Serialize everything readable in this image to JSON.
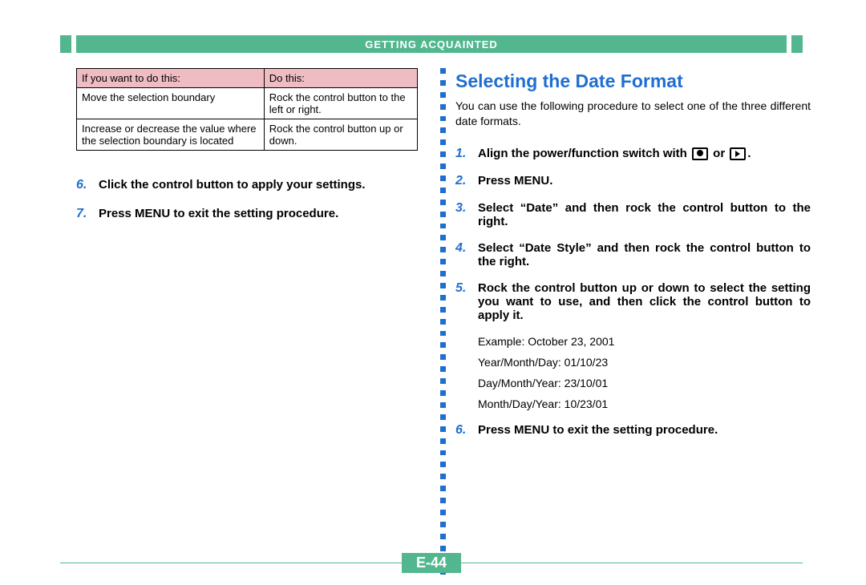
{
  "header": {
    "section": "GETTING ACQUAINTED"
  },
  "left": {
    "table": {
      "head1": "If you want to do this:",
      "head2": "Do this:",
      "rows": [
        {
          "c1": "Move the selection boundary",
          "c2": "Rock the control button to the left or right."
        },
        {
          "c1": "Increase or decrease the value where the selection boundary is located",
          "c2": "Rock the control button up or down."
        }
      ]
    },
    "steps": [
      {
        "n": "6.",
        "t": "Click the control button to apply your settings."
      },
      {
        "n": "7.",
        "t": "Press MENU to exit the setting procedure."
      }
    ]
  },
  "right": {
    "title": "Selecting the Date Format",
    "lead": "You can use the following procedure to select one of the three different date formats.",
    "steps": [
      {
        "n": "1.",
        "t_pre": "Align the power/function switch with ",
        "t_post": " or ",
        "t_end": "."
      },
      {
        "n": "2.",
        "t": "Press MENU."
      },
      {
        "n": "3.",
        "t": "Select “Date” and then rock the control button to the right."
      },
      {
        "n": "4.",
        "t": "Select “Date Style” and then rock the control button to the right."
      },
      {
        "n": "5.",
        "t": "Rock the control button up or down to select the setting you want to use, and then click the control button to apply it."
      }
    ],
    "example": {
      "label": "Example: October 23, 2001",
      "lines": [
        "Year/Month/Day: 01/10/23",
        "Day/Month/Year: 23/10/01",
        "Month/Day/Year: 10/23/01"
      ]
    },
    "step6": {
      "n": "6.",
      "t": "Press MENU to exit the setting procedure."
    }
  },
  "page_number": "E-44"
}
